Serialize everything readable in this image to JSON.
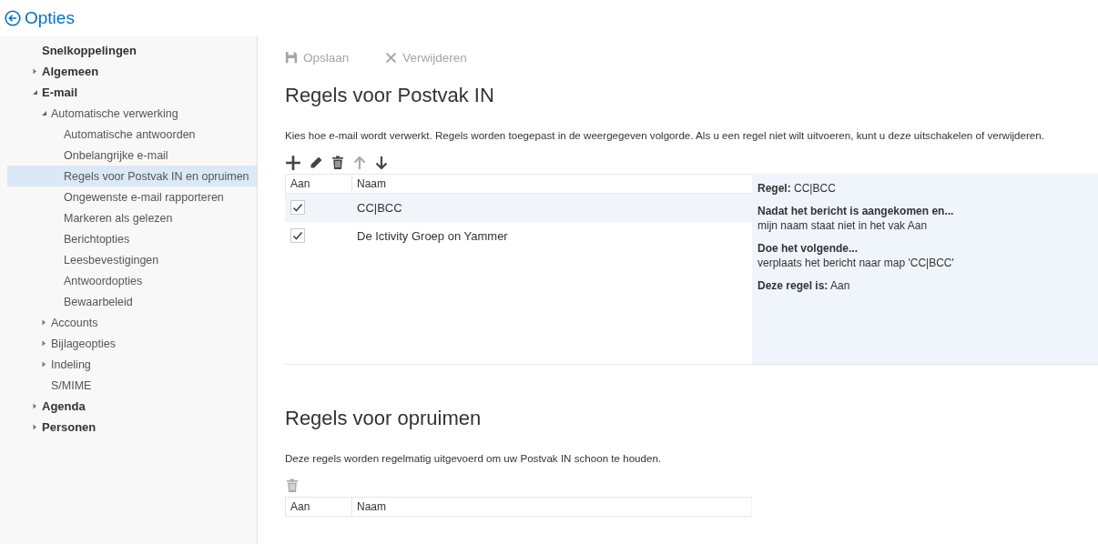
{
  "header": {
    "title": "Opties"
  },
  "sidebar": {
    "items": [
      {
        "label": "Snelkoppelingen",
        "selected": false
      },
      {
        "label": "Algemeen",
        "expanded": false,
        "selected": false
      },
      {
        "label": "E-mail",
        "expanded": true,
        "selected": false,
        "children": [
          {
            "label": "Automatische verwerking",
            "expanded": true,
            "selected": false,
            "children": [
              {
                "label": "Automatische antwoorden",
                "selected": false
              },
              {
                "label": "Onbelangrijke e-mail",
                "selected": false
              },
              {
                "label": "Regels voor Postvak IN en opruimen",
                "selected": true
              },
              {
                "label": "Ongewenste e-mail rapporteren",
                "selected": false
              },
              {
                "label": "Markeren als gelezen",
                "selected": false
              },
              {
                "label": "Berichtopties",
                "selected": false
              },
              {
                "label": "Leesbevestigingen",
                "selected": false
              },
              {
                "label": "Antwoordopties",
                "selected": false
              },
              {
                "label": "Bewaarbeleid",
                "selected": false
              }
            ]
          },
          {
            "label": "Accounts",
            "expanded": false,
            "selected": false
          },
          {
            "label": "Bijlageopties",
            "expanded": false,
            "selected": false
          },
          {
            "label": "Indeling",
            "expanded": false,
            "selected": false
          },
          {
            "label": "S/MIME",
            "selected": false
          }
        ]
      },
      {
        "label": "Agenda",
        "expanded": false,
        "selected": false
      },
      {
        "label": "Personen",
        "expanded": false,
        "selected": false
      }
    ]
  },
  "command_bar": [
    {
      "label": "Opslaan",
      "kind": "save",
      "disabled": true
    },
    {
      "label": "Verwijderen",
      "kind": "delete",
      "disabled": true
    }
  ],
  "inbox_rules": {
    "title": "Regels voor Postvak IN",
    "description": "Kies hoe e-mail wordt verwerkt. Regels worden toegepast in de weergegeven volgorde. Als u een regel niet wilt uitvoeren, kunt u deze uitschakelen of verwijderen.",
    "tools": [
      {
        "kind": "add",
        "disabled": false
      },
      {
        "kind": "edit",
        "disabled": false
      },
      {
        "kind": "delete",
        "disabled": false
      },
      {
        "kind": "up",
        "disabled": true
      },
      {
        "kind": "down",
        "disabled": false
      }
    ],
    "columns": [
      "Aan",
      "Naam"
    ],
    "rows": [
      {
        "name": "CC|BCC",
        "checked": true,
        "selected": true
      },
      {
        "name": "De Ictivity Groep on Yammer",
        "checked": true,
        "selected": false
      }
    ],
    "details": [
      {
        "kind": "line",
        "text": "**Regel:** CC|BCC"
      },
      {
        "kind": "heading",
        "text": "Nadat het bericht is aangekomen en..."
      },
      {
        "kind": "text",
        "text": "mijn naam staat niet in het vak Aan"
      },
      {
        "kind": "heading",
        "text": "Doe het volgende..."
      },
      {
        "kind": "text",
        "text": "verplaats het bericht naar map 'CC|BCC'"
      },
      {
        "kind": "line",
        "text": "**Deze regel is:** Aan"
      }
    ]
  },
  "sweep_rules": {
    "title": "Regels voor opruimen",
    "description": "Deze regels worden regelmatig uitgevoerd om uw Postvak IN schoon te houden.",
    "tools": [
      {
        "kind": "delete",
        "disabled": true
      }
    ],
    "columns": [
      "Aan",
      "Naam"
    ]
  }
}
